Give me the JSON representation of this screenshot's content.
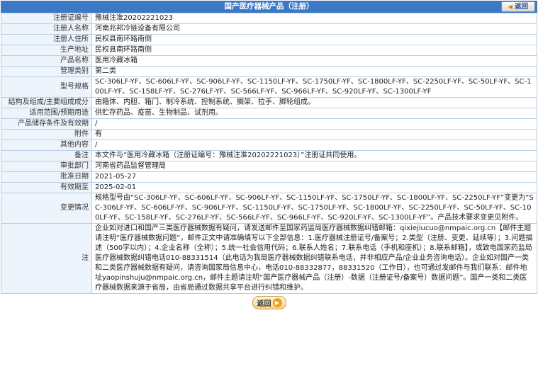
{
  "header": {
    "title": "国产医疗器械产品（注册）",
    "back_label": "返回",
    "back_icon": "arrow-left-icon"
  },
  "rows": [
    {
      "label": "注册证编号",
      "value": "豫械注准20202221023"
    },
    {
      "label": "注册人名称",
      "value": "河南兆邦冷链设备有限公司"
    },
    {
      "label": "注册人住所",
      "value": "民权县南环路南侧"
    },
    {
      "label": "生产地址",
      "value": "民权县南环路南侧"
    },
    {
      "label": "产品名称",
      "value": "医用冷藏冰箱"
    },
    {
      "label": "管理类别",
      "value": "第二类"
    },
    {
      "label": "型号规格",
      "value": "SC-306LF-YF、SC-606LF-YF、SC-906LF-YF、SC-1150LF-YF、SC-1750LF-YF、SC-1800LF-YF、SC-2250LF-YF、SC-50LF-YF、SC-100LF-YF、SC-158LF-YF、SC-276LF-YF、SC-566LF-YF、SC-966LF-YF、SC-920LF-YF、SC-1300LF-YF"
    },
    {
      "label": "结构及组成/主要组成成分",
      "value": "由箱体、内胆、箱门、制冷系统、控制系统、搁架、拉手、脚轮组成。"
    },
    {
      "label": "适用范围/预期用途",
      "value": "供贮存药品、疫苗、生物制品、试剂用。"
    },
    {
      "label": "产品储存条件及有效期",
      "value": "/"
    },
    {
      "label": "附件",
      "value": "有"
    },
    {
      "label": "其他内容",
      "value": "/"
    },
    {
      "label": "备注",
      "value": "本文件与“医用冷藏冰箱（注册证编号：豫械注准20202221023）”注册证共同使用。"
    },
    {
      "label": "审批部门",
      "value": "河南省药品监督管理局"
    },
    {
      "label": "批准日期",
      "value": "2021-05-27"
    },
    {
      "label": "有效期至",
      "value": "2025-02-01"
    },
    {
      "label": "变更情况",
      "value": "规格型号由“SC-306LF-YF、SC-606LF-YF、SC-906LF-YF、SC-1150LF-YF、SC-1750LF-YF、SC-1800LF-YF、SC-2250LF-YF”变更为“SC-306LF-YF、SC-606LF-YF、SC-906LF-YF、SC-1150LF-YF、SC-1750LF-YF、SC-1800LF-YF、SC-2250LF-YF、SC-50LF-YF、SC-100LF-YF、SC-158LF-YF、SC-276LF-YF、SC-566LF-YF、SC-966LF-YF、SC-920LF-YF、SC-1300LF-YF”。产品技术要求变更见附件。"
    },
    {
      "label": "注",
      "value": "企业如对进口和国产三类医疗器械数据有疑问，请发送邮件至国家药监局医疗器械数据纠错邮箱：qixiejiucuo@nmpaic.org.cn【邮件主题请注明“医疗器械数据问题”，邮件正文中请准确填写以下全部信息：1.医疗器械注册证号/备案号；2.类型（注册、变更、延续等）；3.问题描述（500字以内）；4.企业名称（全称）；5.统一社会信用代码；6.联系人姓名；7.联系电话（手机和座机）；8.联系邮箱】，或致电国家药监局医疗器械数据纠错电话010-88331514（此电话为我局医疗器械数据纠错联系电话，并非相应产品/企业业务咨询电话）。企业如对国产一类和二类医疗器械数据有疑问，请咨询国家局信息中心，电话010-88332877，88331520（工作日），也可通过发邮件与我们联系：邮件地址yaopinshuju@nmpaic.org.cn，邮件主题请注明“国产医疗器械产品（注册）-数据（注册证号/备案号）数据问题”。国产一类和二类医疗器械数据来源于省局，由省局通过数据共享平台进行纠错和维护。"
    }
  ],
  "footer": {
    "back_label": "返回",
    "back_icon": "arrow-right-circle-icon"
  }
}
